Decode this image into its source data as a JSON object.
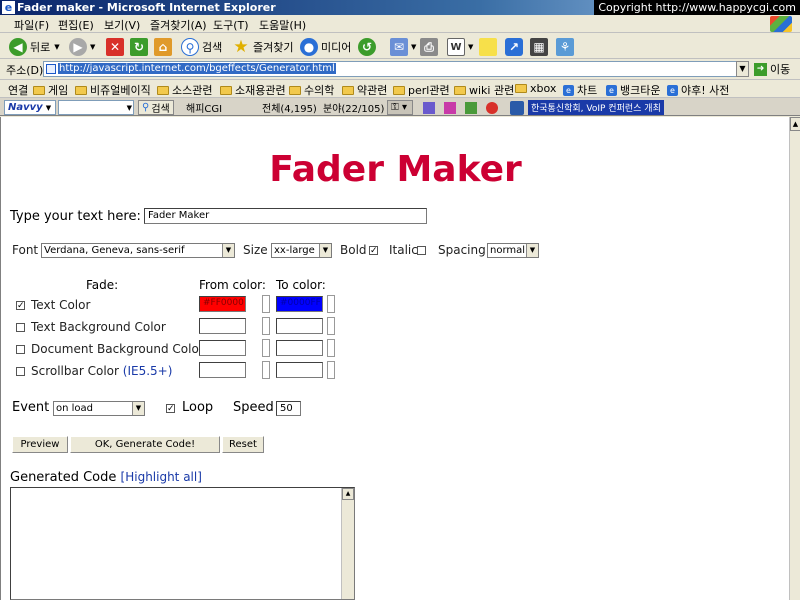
{
  "window": {
    "title": "Fader maker - Microsoft Internet Explorer",
    "overlay": "Copyright  http://www.happycgi.com"
  },
  "menu": [
    "파일(F)",
    "편집(E)",
    "보기(V)",
    "즐겨찾기(A)",
    "도구(T)",
    "도움말(H)"
  ],
  "toolbar": {
    "back": "뒤로",
    "search": "검색",
    "favorites": "즐겨찾기",
    "media": "미디어"
  },
  "address": {
    "label": "주소(D)",
    "url": "http://javascript.internet.com/bgeffects/Generator.html",
    "go": "이동"
  },
  "links": {
    "label": "연결",
    "items": [
      "게임",
      "비쥬얼베이직",
      "소스관련",
      "소재용관련",
      "수의학",
      "약관련",
      "perl관련",
      "wiki 관련",
      "xbox",
      "차트",
      "뱅크타운",
      "야후! 사전"
    ]
  },
  "navvy": {
    "brand": "Navvy",
    "search": "검색",
    "site": "해피CGI",
    "total": "전체(4,195)",
    "category": "분야(22/105)",
    "ticker": "한국통신학회, VoIP 컨퍼런스 개최"
  },
  "page": {
    "heading": "Fader Maker",
    "text_label": "Type your text here:",
    "text_value": "Fader Maker",
    "font_label": "Font",
    "font_value": "Verdana, Geneva, sans-serif",
    "size_label": "Size",
    "size_value": "xx-large",
    "bold_label": "Bold",
    "italic_label": "Italic",
    "spacing_label": "Spacing",
    "spacing_value": "normal",
    "fade_header": "Fade:",
    "from_header": "From color:",
    "to_header": "To color:",
    "rows": [
      {
        "label": "Text Color",
        "checked": true,
        "from": "#FF0000",
        "to": "#0000FF"
      },
      {
        "label": "Text Background Color",
        "checked": false,
        "from": "",
        "to": ""
      },
      {
        "label": "Document Background Color",
        "checked": false,
        "from": "",
        "to": ""
      },
      {
        "label": "Scrollbar Color",
        "suffix": "(IE5.5+)",
        "checked": false,
        "from": "",
        "to": ""
      }
    ],
    "event_label": "Event",
    "event_value": "on load",
    "loop_label": "Loop",
    "speed_label": "Speed",
    "speed_value": "50",
    "preview_button": "Preview",
    "generate_button": "OK, Generate Code!",
    "reset_button": "Reset",
    "generated_label": "Generated Code",
    "highlight_link": "[Highlight all]"
  },
  "colors": {
    "heading": "#cc0033",
    "from_swatch": "#ff0000",
    "to_swatch": "#0000ff",
    "link": "#1a3aa8"
  }
}
